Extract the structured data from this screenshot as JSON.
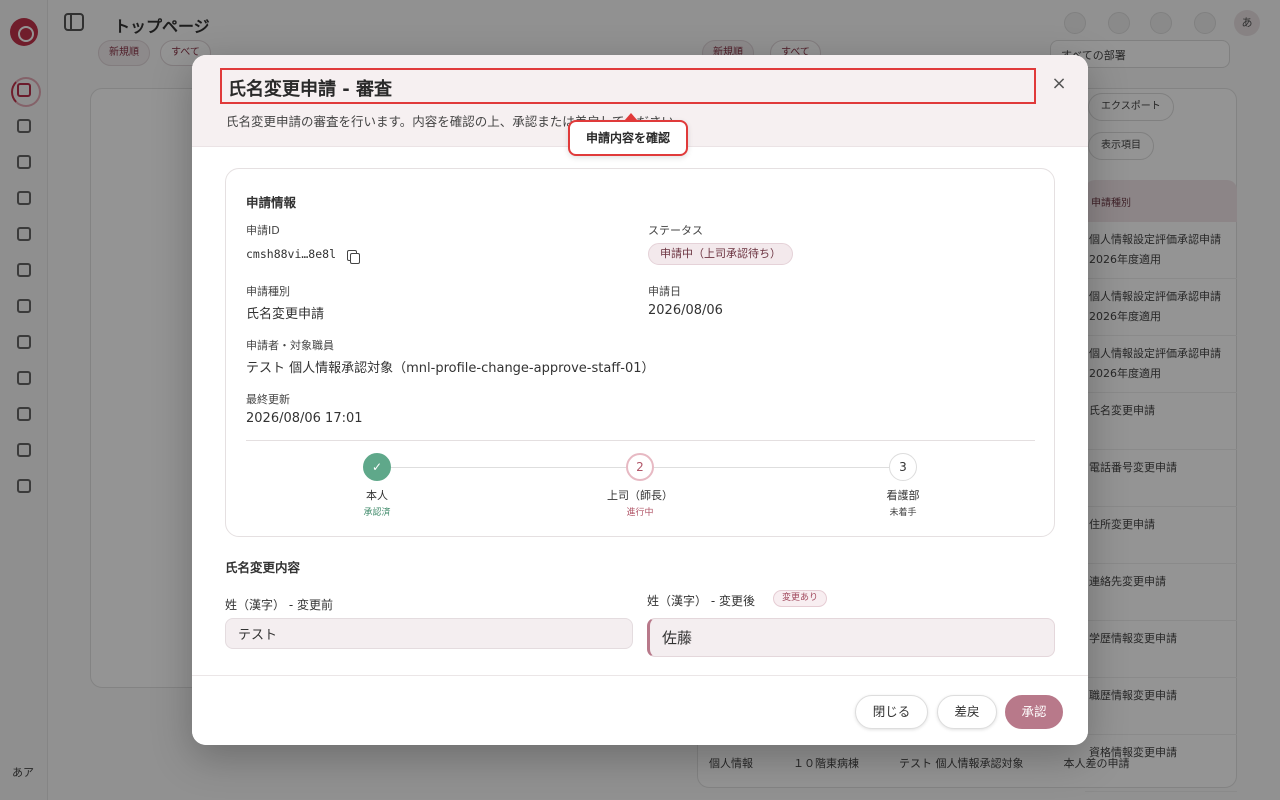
{
  "app": {
    "page_title": "トップページ",
    "user_initials": "あ",
    "rail_user": "あア",
    "filter_pills": [
      "新規順",
      "すべて"
    ],
    "department_select": "すべての部署",
    "export_button": "エクスポート",
    "display_settings": "表示項目",
    "table_header": "申請種別",
    "table_rows": [
      "個人情報設定評価承認申請 2026年度適用",
      "個人情報設定評価承認申請 2026年度適用",
      "個人情報設定評価承認申請 2026年度適用",
      "氏名変更申請",
      "電話番号変更申請",
      "住所変更申請",
      "連絡先変更申請",
      "学歴情報変更申請",
      "職歴情報変更申請",
      "資格情報変更申請"
    ],
    "bottom_row": [
      "個人情報",
      "１０階東病棟",
      "テスト 個人情報承認対象",
      "本人差の申請"
    ]
  },
  "modal": {
    "title": "氏名変更申請 - 審査",
    "description": "氏名変更申請の審査を行います。内容を確認の上、承認または差戻してください。",
    "callout": "申請内容を確認",
    "info": {
      "section_title": "申請情報",
      "id_label": "申請ID",
      "id_value": "cmsh88vi…8e8l",
      "status_label": "ステータス",
      "status_value": "申請中（上司承認待ち）",
      "type_label": "申請種別",
      "type_value": "氏名変更申請",
      "date_label": "申請日",
      "date_value": "2026/08/06",
      "applicant_label": "申請者・対象職員",
      "applicant_value": "テスト 個人情報承認対象（mnl-profile-change-approve-staff-01）",
      "updated_label": "最終更新",
      "updated_value": "2026/08/06 17:01"
    },
    "steps": [
      {
        "num": "✓",
        "name": "本人",
        "state": "承認済"
      },
      {
        "num": "2",
        "name": "上司（師長）",
        "state": "進行中"
      },
      {
        "num": "3",
        "name": "看護部",
        "state": "未着手"
      }
    ],
    "change": {
      "section_title": "氏名変更内容",
      "before_label": "姓（漢字） - 変更前",
      "before_value": "テスト",
      "after_label": "姓（漢字） - 変更後",
      "after_badge": "変更あり",
      "after_value": "佐藤"
    },
    "buttons": {
      "close": "閉じる",
      "return": "差戻",
      "approve": "承認"
    }
  },
  "colors": {
    "accent": "#b8798a",
    "brand": "#c2334a",
    "success": "#5fa88a",
    "highlight": "#e03a3a"
  }
}
